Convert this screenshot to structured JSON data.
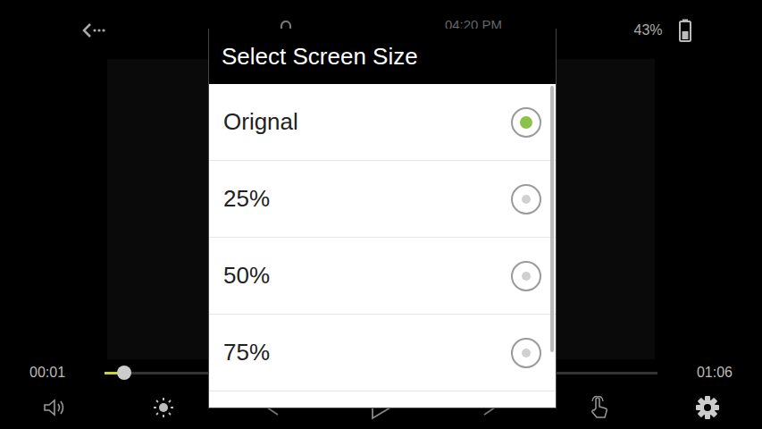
{
  "top_bar": {
    "time": "04:20 PM",
    "battery": "43%"
  },
  "seek": {
    "current": "00:01",
    "total": "01:06",
    "level": 0.03
  },
  "dialog": {
    "title": "Select Screen Size",
    "options": [
      {
        "label": "Orignal",
        "selected": true
      },
      {
        "label": "25%",
        "selected": false
      },
      {
        "label": "50%",
        "selected": false
      },
      {
        "label": "75%",
        "selected": false
      }
    ]
  }
}
